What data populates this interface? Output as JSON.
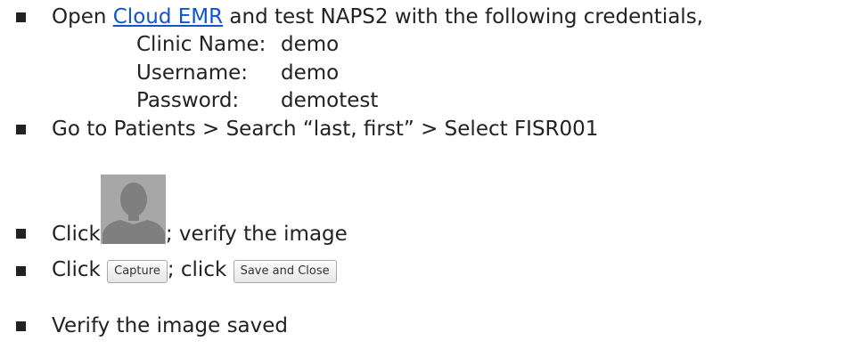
{
  "steps": [
    {
      "before": "Open ",
      "link": "Cloud EMR",
      "after": " and test NAPS2 with the following credentials,"
    },
    {
      "text": "Go to Patients > Search “last, first” > Select FISR001"
    },
    {
      "before": "Click ",
      "after": "; verify the image",
      "image_icon": "patient-avatar-placeholder"
    },
    {
      "before": "Click ",
      "button1": "Capture",
      "middle": "; click ",
      "button2": "Save and Close"
    },
    {
      "text": "Verify the image saved"
    }
  ],
  "credentials": [
    {
      "label": "Clinic Name:",
      "value": "demo"
    },
    {
      "label": "Username:",
      "value": "demo"
    },
    {
      "label": "Password:",
      "value": "demotest"
    }
  ],
  "colors": {
    "text": "#222222",
    "link": "#1155cc",
    "avatar_bg": "#a4a4a4",
    "avatar_silhouette": "#7d7d7d"
  }
}
